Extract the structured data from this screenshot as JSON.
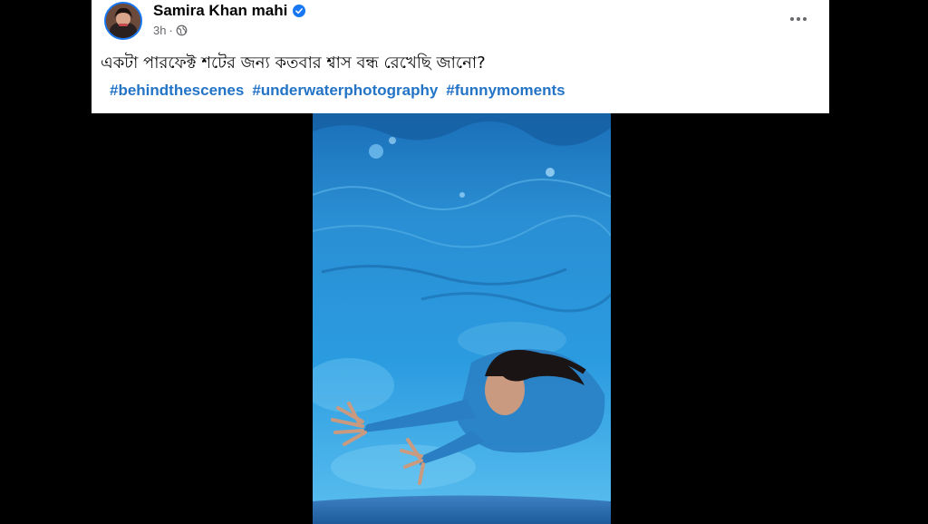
{
  "post": {
    "author": "Samira Khan mahi",
    "time": "3h",
    "separator": "·",
    "caption": "একটা পারফেক্ট শটের জন্য কতবার শ্বাস বন্ধ রেখেছি জানো?",
    "hashtags": [
      "#behindthescenes",
      "#underwaterphotography",
      "#funnymoments"
    ]
  },
  "icons": {
    "verified": "verified-badge-icon",
    "audience": "globe-icon",
    "more": "more-options-icon"
  },
  "colors": {
    "hashtag": "#2374c6",
    "verified": "#1877f2",
    "water": "#1f8fd0"
  }
}
